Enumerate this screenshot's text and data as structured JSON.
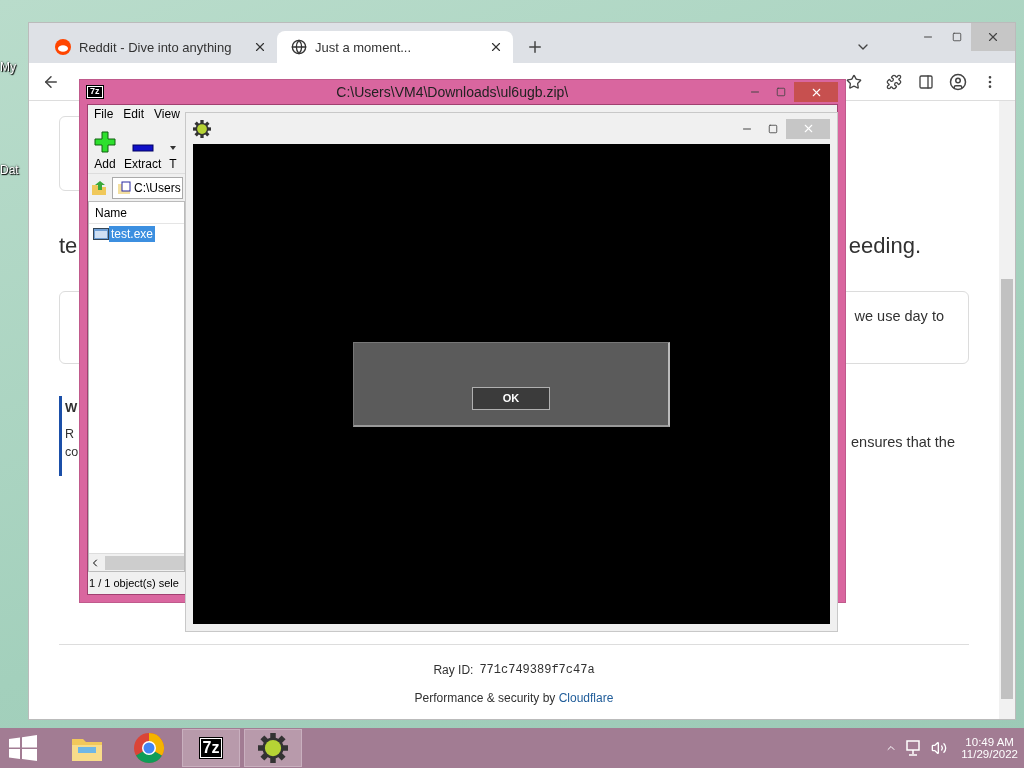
{
  "desktop": {
    "icons": [
      {
        "label": "My"
      },
      {
        "label": "Dat"
      }
    ]
  },
  "browser": {
    "tabs": [
      {
        "title": "Reddit - Dive into anything",
        "selected": false
      },
      {
        "title": "Just a moment...",
        "selected": true
      }
    ],
    "page": {
      "heading": {
        "left": "te",
        "right": "eeding."
      },
      "card": {
        "right": "we use day to"
      },
      "quote": {
        "left_lines": [
          "W",
          "R",
          "co"
        ],
        "right": "ensures that the"
      },
      "ray_label": "Ray ID:",
      "ray_id": "771c749389f7c47a",
      "footer": "Performance & security by",
      "footer_link": "Cloudflare"
    }
  },
  "archive_window": {
    "icon_text": "7z",
    "title": "C:\\Users\\VM4\\Downloads\\ul6ugb.zip\\",
    "menu": [
      "File",
      "Edit",
      "View"
    ],
    "toolbar": [
      {
        "label": "Add",
        "kind": "add"
      },
      {
        "label": "Extract",
        "kind": "extract"
      },
      {
        "label": "T",
        "kind": "test"
      }
    ],
    "path": "C:\\Users",
    "columns": [
      "Name"
    ],
    "files": [
      {
        "name": "test.exe",
        "selected": true
      }
    ],
    "status": "1 / 1 object(s) sele"
  },
  "app_window": {
    "dialog": {
      "button": "OK"
    }
  },
  "taskbar": {
    "apps": [
      {
        "kind": "explorer",
        "active": false
      },
      {
        "kind": "chrome",
        "active": false
      },
      {
        "kind": "archiver",
        "label": "7z",
        "active": true
      },
      {
        "kind": "gear",
        "active": true
      }
    ],
    "time": "10:49 AM",
    "date": "11/29/2022"
  }
}
